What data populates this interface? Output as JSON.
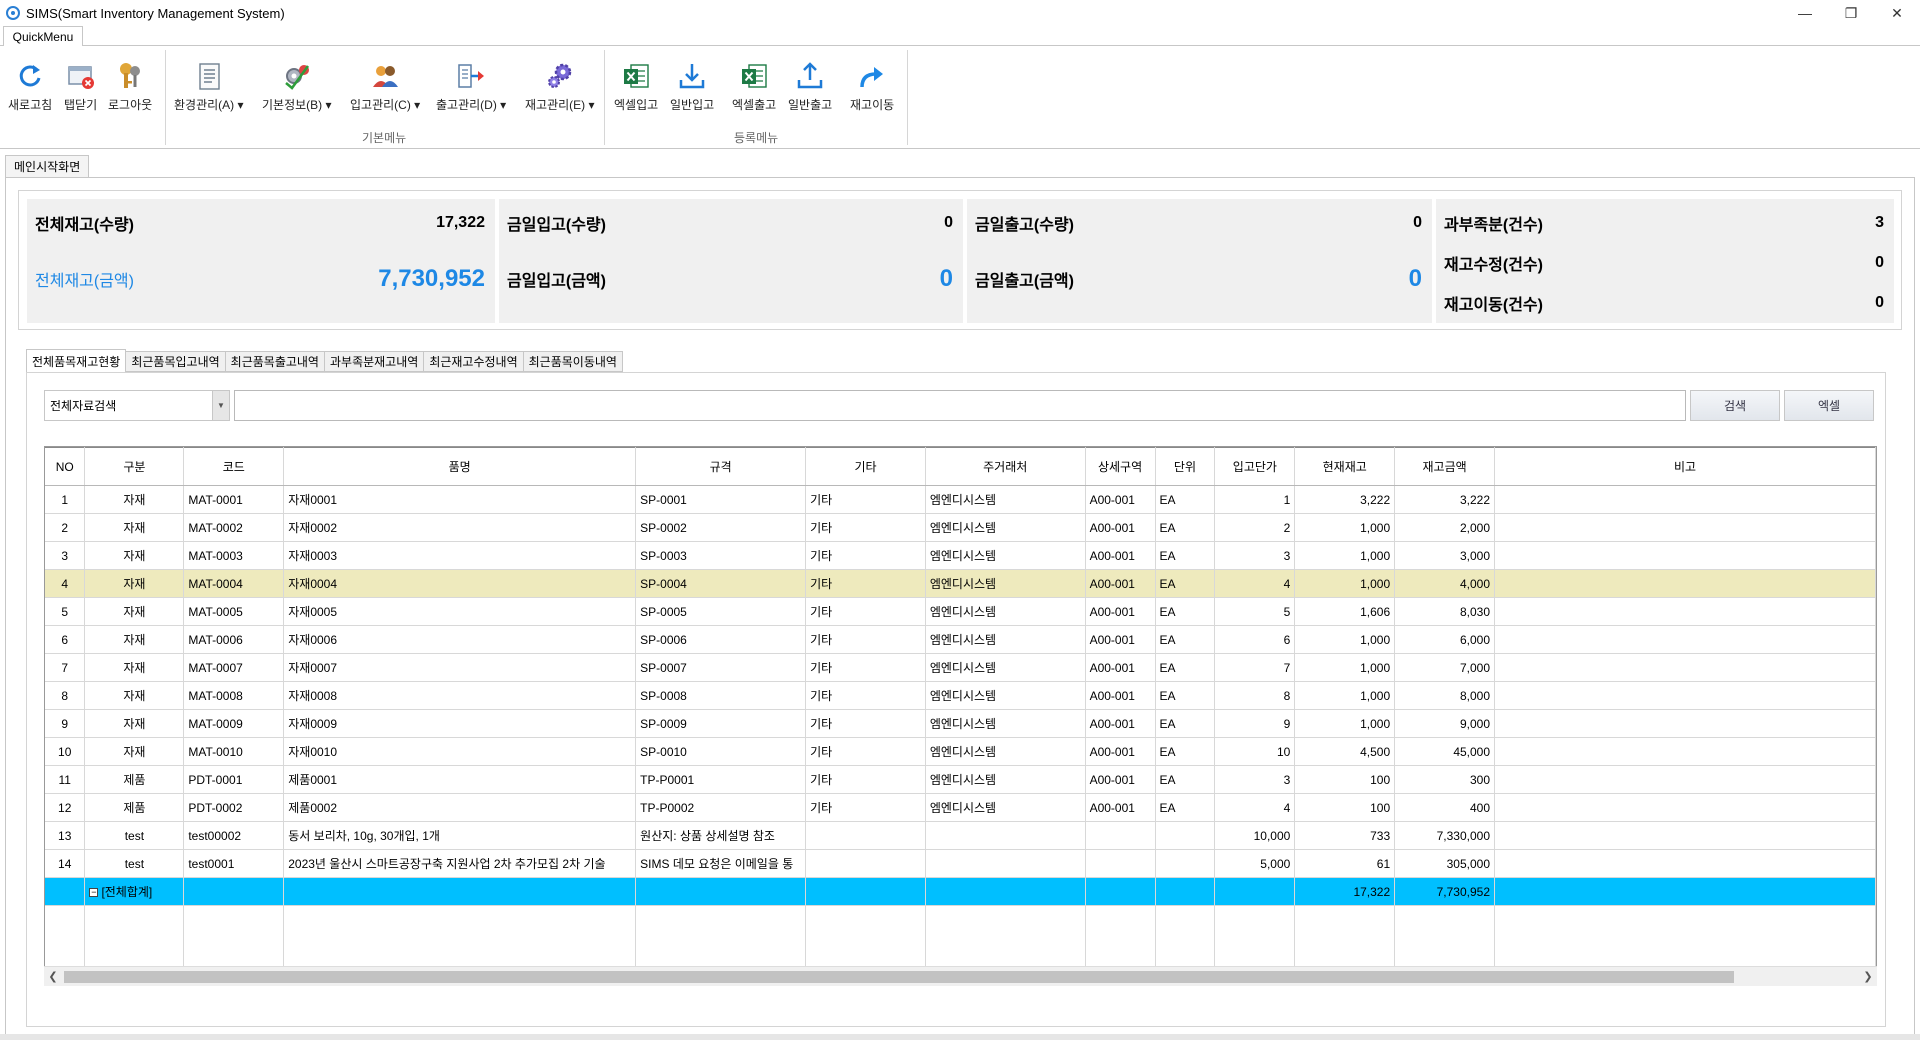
{
  "window": {
    "title": "SIMS(Smart Inventory Management System)",
    "controls": [
      "minimize",
      "restore",
      "close"
    ]
  },
  "menu_tab": "QuickMenu",
  "ribbon": {
    "buttons": [
      {
        "label": "새로고침",
        "icon": "refresh-icon"
      },
      {
        "label": "탭닫기",
        "icon": "close-tab-icon"
      },
      {
        "label": "로그아웃",
        "icon": "keys-icon"
      },
      {
        "label": "환경관리(A)",
        "icon": "document-settings-icon",
        "dropdown": true
      },
      {
        "label": "기본정보(B)",
        "icon": "gear-check-icon",
        "dropdown": true
      },
      {
        "label": "입고관리(C)",
        "icon": "users-icon",
        "dropdown": true
      },
      {
        "label": "출고관리(D)",
        "icon": "outbound-icon",
        "dropdown": true
      },
      {
        "label": "재고관리(E)",
        "icon": "gears-icon",
        "dropdown": true
      },
      {
        "label": "엑셀입고",
        "icon": "excel-icon"
      },
      {
        "label": "일반입고",
        "icon": "download-tray-icon"
      },
      {
        "label": "엑셀출고",
        "icon": "excel-icon"
      },
      {
        "label": "일반출고",
        "icon": "upload-tray-icon"
      },
      {
        "label": "재고이동",
        "icon": "share-arrow-icon"
      }
    ],
    "groups": {
      "basic": "기본메뉴",
      "register": "등록메뉴"
    }
  },
  "doc_tab": "메인시작화면",
  "summary": {
    "total_qty_label": "전체재고(수량)",
    "total_qty": "17,322",
    "total_amt_label": "전체재고(금액)",
    "total_amt": "7,730,952",
    "in_qty_label": "금일입고(수량)",
    "in_qty": "0",
    "in_amt_label": "금일입고(금액)",
    "in_amt": "0",
    "out_qty_label": "금일출고(수량)",
    "out_qty": "0",
    "out_amt_label": "금일출고(금액)",
    "out_amt": "0",
    "shortage_label": "과부족분(건수)",
    "shortage": "3",
    "adjust_label": "재고수정(건수)",
    "adjust": "0",
    "move_label": "재고이동(건수)",
    "move": "0"
  },
  "inner_tabs": [
    "전체품목재고현황",
    "최근품목입고내역",
    "최근품목출고내역",
    "과부족분재고내역",
    "최근재고수정내역",
    "최근품목이동내역"
  ],
  "search": {
    "combo_value": "전체자료검색",
    "input_value": "",
    "search_label": "검색",
    "excel_label": "엑셀"
  },
  "grid": {
    "columns": [
      "NO",
      "구분",
      "코드",
      "품명",
      "규격",
      "기타",
      "주거래처",
      "상세구역",
      "단위",
      "입고단가",
      "현재재고",
      "재고금액",
      "비고"
    ],
    "rows": [
      [
        "1",
        "자재",
        "MAT-0001",
        "자재0001",
        "SP-0001",
        "기타",
        "엠엔디시스템",
        "A00-001",
        "EA",
        "1",
        "3,222",
        "3,222",
        ""
      ],
      [
        "2",
        "자재",
        "MAT-0002",
        "자재0002",
        "SP-0002",
        "기타",
        "엠엔디시스템",
        "A00-001",
        "EA",
        "2",
        "1,000",
        "2,000",
        ""
      ],
      [
        "3",
        "자재",
        "MAT-0003",
        "자재0003",
        "SP-0003",
        "기타",
        "엠엔디시스템",
        "A00-001",
        "EA",
        "3",
        "1,000",
        "3,000",
        ""
      ],
      [
        "4",
        "자재",
        "MAT-0004",
        "자재0004",
        "SP-0004",
        "기타",
        "엠엔디시스템",
        "A00-001",
        "EA",
        "4",
        "1,000",
        "4,000",
        ""
      ],
      [
        "5",
        "자재",
        "MAT-0005",
        "자재0005",
        "SP-0005",
        "기타",
        "엠엔디시스템",
        "A00-001",
        "EA",
        "5",
        "1,606",
        "8,030",
        ""
      ],
      [
        "6",
        "자재",
        "MAT-0006",
        "자재0006",
        "SP-0006",
        "기타",
        "엠엔디시스템",
        "A00-001",
        "EA",
        "6",
        "1,000",
        "6,000",
        ""
      ],
      [
        "7",
        "자재",
        "MAT-0007",
        "자재0007",
        "SP-0007",
        "기타",
        "엠엔디시스템",
        "A00-001",
        "EA",
        "7",
        "1,000",
        "7,000",
        ""
      ],
      [
        "8",
        "자재",
        "MAT-0008",
        "자재0008",
        "SP-0008",
        "기타",
        "엠엔디시스템",
        "A00-001",
        "EA",
        "8",
        "1,000",
        "8,000",
        ""
      ],
      [
        "9",
        "자재",
        "MAT-0009",
        "자재0009",
        "SP-0009",
        "기타",
        "엠엔디시스템",
        "A00-001",
        "EA",
        "9",
        "1,000",
        "9,000",
        ""
      ],
      [
        "10",
        "자재",
        "MAT-0010",
        "자재0010",
        "SP-0010",
        "기타",
        "엠엔디시스템",
        "A00-001",
        "EA",
        "10",
        "4,500",
        "45,000",
        ""
      ],
      [
        "11",
        "제품",
        "PDT-0001",
        "제품0001",
        "TP-P0001",
        "기타",
        "엠엔디시스템",
        "A00-001",
        "EA",
        "3",
        "100",
        "300",
        ""
      ],
      [
        "12",
        "제품",
        "PDT-0002",
        "제품0002",
        "TP-P0002",
        "기타",
        "엠엔디시스템",
        "A00-001",
        "EA",
        "4",
        "100",
        "400",
        ""
      ],
      [
        "13",
        "test",
        "test00002",
        "동서 보리차, 10g, 30개입, 1개",
        "원산지: 상품 상세설명 참조",
        "",
        "",
        "",
        "",
        "10,000",
        "733",
        "7,330,000",
        ""
      ],
      [
        "14",
        "test",
        "test0001",
        "2023년 울산시 스마트공장구축 지원사업 2차 추가모집 2차 기술",
        "SIMS 데모 요청은 이메일을 통",
        "",
        "",
        "",
        "",
        "5,000",
        "61",
        "305,000",
        ""
      ]
    ],
    "selected_row": 3,
    "total": {
      "label": "[전체합계]",
      "stock": "17,322",
      "amount": "7,730,952"
    }
  },
  "colors": {
    "accent": "#1e88e5",
    "selected_row": "#eeeabd",
    "total_row": "#00bfff"
  }
}
